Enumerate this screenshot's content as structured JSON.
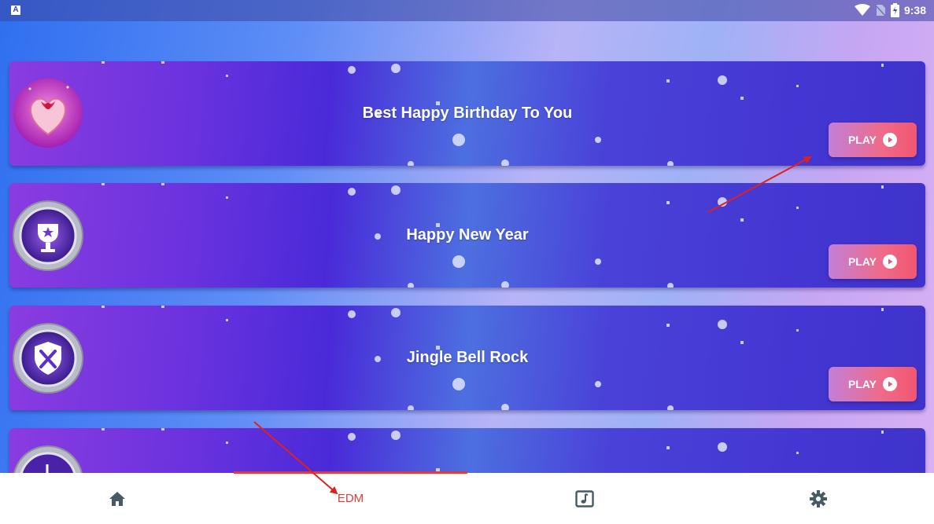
{
  "status_bar": {
    "time": "9:38",
    "app_icon": "A"
  },
  "songs": [
    {
      "title": "Best Happy Birthday To You",
      "play_label": "PLAY",
      "badge_icon": "heart-gift-icon"
    },
    {
      "title": "Happy New Year",
      "play_label": "PLAY",
      "badge_icon": "trophy-badge-icon"
    },
    {
      "title": "Jingle Bell Rock",
      "play_label": "PLAY",
      "badge_icon": "shield-swords-badge-icon"
    },
    {
      "title": "",
      "play_label": "",
      "badge_icon": "music-note-badge-icon"
    }
  ],
  "bottom_nav": {
    "items": [
      {
        "icon": "home-icon",
        "label": ""
      },
      {
        "icon": "",
        "label": "EDM"
      },
      {
        "icon": "music-note-icon",
        "label": ""
      },
      {
        "icon": "gear-icon",
        "label": ""
      }
    ],
    "active_index": 1
  },
  "colors": {
    "accent": "#e53935",
    "card": "#4a2ad8",
    "play_button_start": "#c27fd8",
    "play_button_end": "#f2566f",
    "annotation_arrow": "#e0201c"
  }
}
